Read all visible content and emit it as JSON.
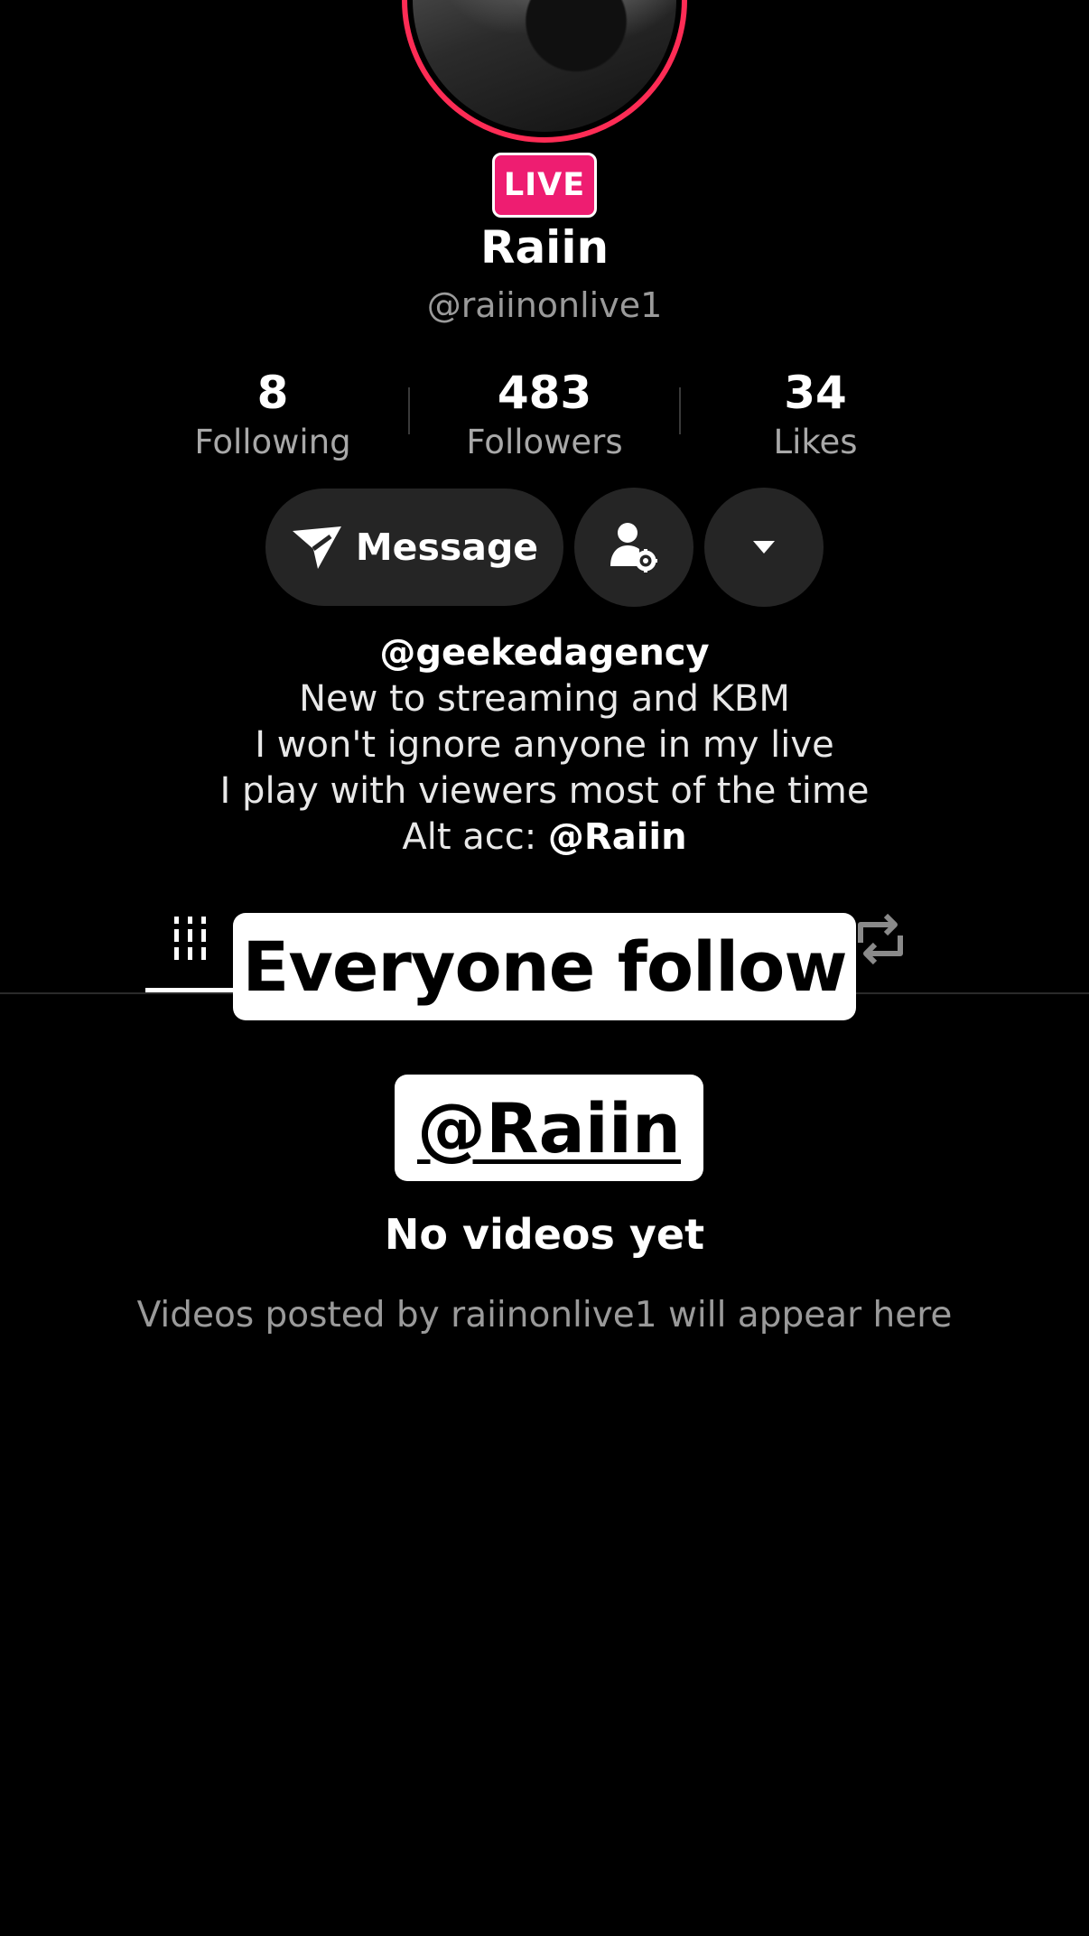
{
  "profile": {
    "live_badge": "LIVE",
    "display_name": "Raiin",
    "username": "@raiinonlive1"
  },
  "stats": [
    {
      "value": "8",
      "label": "Following"
    },
    {
      "value": "483",
      "label": "Followers"
    },
    {
      "value": "34",
      "label": "Likes"
    }
  ],
  "actions": {
    "message_label": "Message",
    "friend_settings_icon": "person-gear-icon",
    "more_icon": "caret-down-icon",
    "message_icon": "paper-plane-icon"
  },
  "bio": {
    "line1": "@geekedagency",
    "line2": "New to streaming and KBM",
    "line3": "I won't ignore anyone in my live",
    "line4": "I play with viewers most of the time",
    "line5_prefix": "Alt acc: ",
    "line5_mention": "@Raiin"
  },
  "tabs": {
    "videos_icon": "grid-icon",
    "reposts_icon": "repost-icon"
  },
  "overlay": {
    "line1": "Everyone follow",
    "line2": "@Raiin"
  },
  "empty_state": {
    "title": "No videos yet",
    "subtitle": "Videos posted by raiinonlive1 will appear here"
  },
  "colors": {
    "accent": "#fe2c55",
    "live": "#ee1d71",
    "background": "#000000",
    "button": "#252525"
  }
}
